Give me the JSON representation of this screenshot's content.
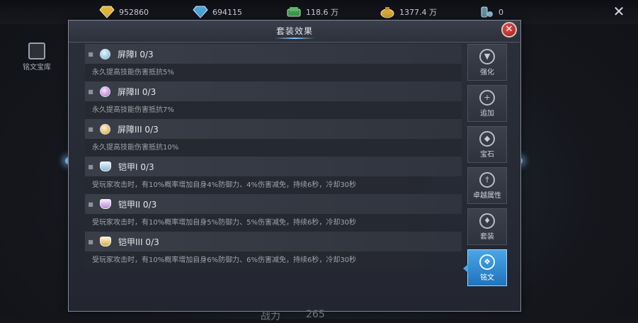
{
  "currencies": [
    {
      "icon": "gold-diamond-icon",
      "value": "952860"
    },
    {
      "icon": "blue-diamond-icon",
      "value": "694115"
    },
    {
      "icon": "green-cash-icon",
      "value": "118.6 万"
    },
    {
      "icon": "gold-coin-bag-icon",
      "value": "1377.4 万"
    },
    {
      "icon": "token-icon",
      "value": "0"
    }
  ],
  "side": {
    "vault_label": "铭文宝库"
  },
  "panel": {
    "title": "套装效果"
  },
  "items": [
    {
      "name": "屏障I 0/3",
      "desc": "永久提高技能伤害抵抗5%",
      "icon": "blue-gem-icon"
    },
    {
      "name": "屏障II 0/3",
      "desc": "永久提高技能伤害抵抗7%",
      "icon": "purple-gem-icon"
    },
    {
      "name": "屏障III 0/3",
      "desc": "永久提高技能伤害抵抗10%",
      "icon": "gold-gem-icon"
    },
    {
      "name": "铠甲I 0/3",
      "desc": "受玩家攻击时，有10%概率增加自身4%防御力、4%伤害减免，持续6秒，冷却30秒",
      "icon": "blue-armor-icon"
    },
    {
      "name": "铠甲II 0/3",
      "desc": "受玩家攻击时，有10%概率增加自身5%防御力、5%伤害减免，持续6秒，冷却30秒",
      "icon": "purple-armor-icon"
    },
    {
      "name": "铠甲III 0/3",
      "desc": "受玩家攻击时，有10%概率增加自身6%防御力、6%伤害减免，持续6秒，冷却30秒",
      "icon": "gold-armor-icon"
    }
  ],
  "tabs": [
    {
      "label": "强化",
      "icon": "anvil-icon",
      "active": false
    },
    {
      "label": "追加",
      "icon": "plus-emblem-icon",
      "active": false
    },
    {
      "label": "宝石",
      "icon": "gem-emblem-icon",
      "active": false
    },
    {
      "label": "卓越属性",
      "icon": "sword-emblem-icon",
      "active": false
    },
    {
      "label": "套装",
      "icon": "wings-emblem-icon",
      "active": false
    },
    {
      "label": "铭文",
      "icon": "inscription-emblem-icon",
      "active": true
    }
  ],
  "bottom": {
    "power_label": "战力",
    "power_value": "265"
  }
}
